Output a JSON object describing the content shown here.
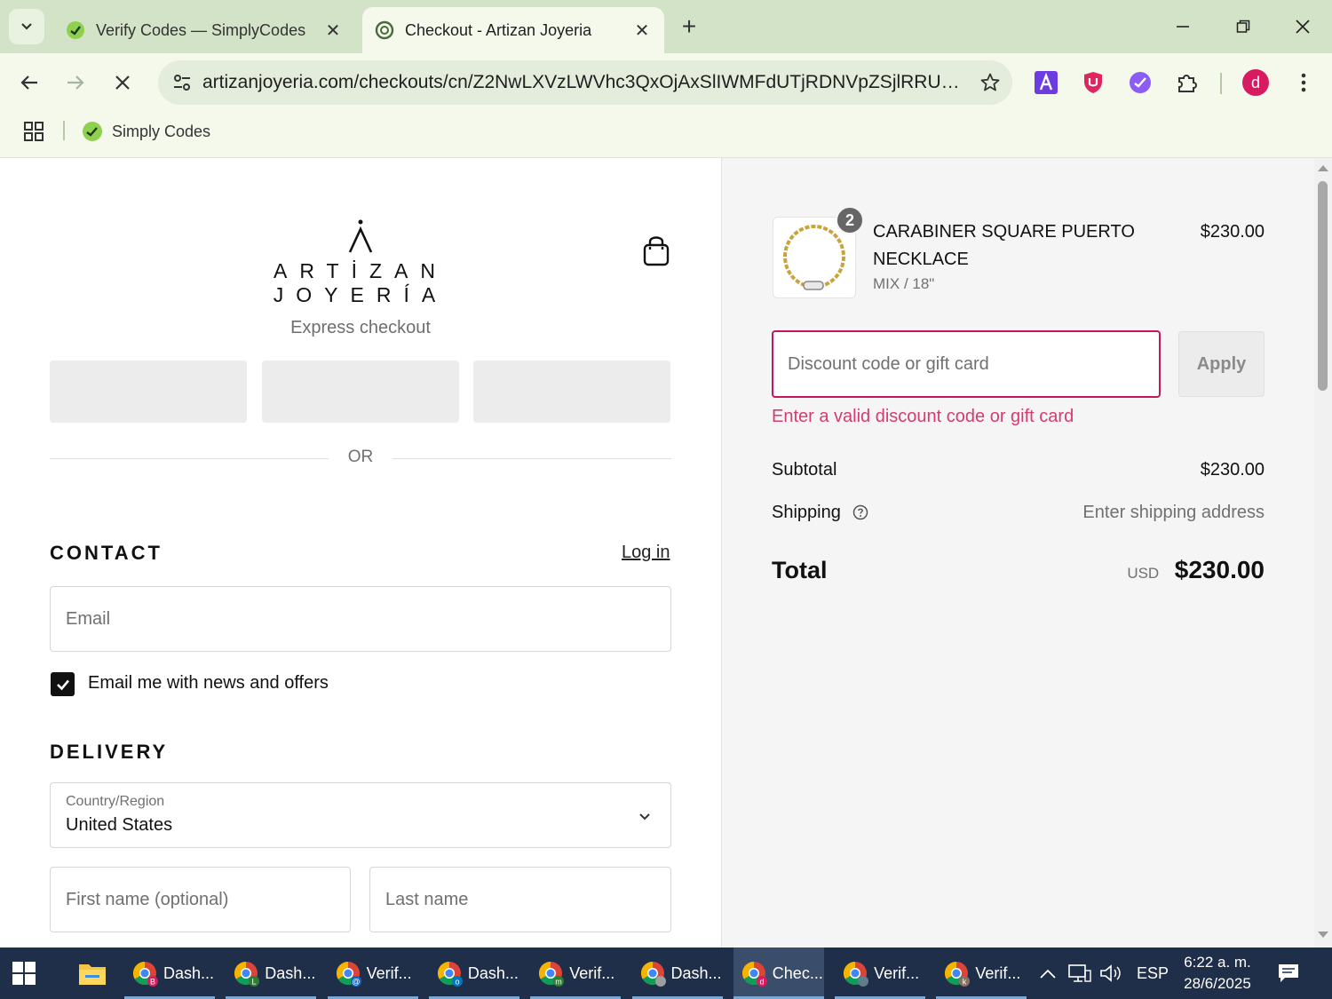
{
  "browser": {
    "tabs": [
      {
        "title": "Verify Codes — SimplyCodes",
        "active": false
      },
      {
        "title": "Checkout - Artizan Joyeria",
        "active": true
      }
    ],
    "url": "artizanjoyeria.com/checkouts/cn/Z2NwLXVzLWVhc3QxOjAxSlIWMFdUTjRDNVpZSjlRRUdGN...",
    "bookmarks": [
      {
        "label": "Simply Codes"
      }
    ],
    "profile_initial": "d"
  },
  "store": {
    "logo_text": "ARTİZAN JOYERÍA",
    "express_checkout_label": "Express checkout",
    "or_label": "OR"
  },
  "contact": {
    "heading": "CONTACT",
    "login_label": "Log in",
    "email_placeholder": "Email",
    "newsletter_label": "Email me with news and offers",
    "newsletter_checked": true
  },
  "delivery": {
    "heading": "DELIVERY",
    "country_label": "Country/Region",
    "country_value": "United States",
    "first_name_placeholder": "First name (optional)",
    "last_name_placeholder": "Last name"
  },
  "summary": {
    "item": {
      "quantity": "2",
      "name": "CARABINER SQUARE PUERTO NECKLACE",
      "variant": "MIX / 18\"",
      "price": "$230.00"
    },
    "discount_placeholder": "Discount code or gift card",
    "apply_label": "Apply",
    "error_message": "Enter a valid discount code or gift card",
    "subtotal_label": "Subtotal",
    "subtotal_value": "$230.00",
    "shipping_label": "Shipping",
    "shipping_value": "Enter shipping address",
    "total_label": "Total",
    "currency": "USD",
    "total_value": "$230.00"
  },
  "taskbar": {
    "items": [
      {
        "label": "Dash...",
        "badge": "B"
      },
      {
        "label": "Dash...",
        "badge": "L"
      },
      {
        "label": "Verif...",
        "badge": "@"
      },
      {
        "label": "Dash...",
        "badge": "o"
      },
      {
        "label": "Verif...",
        "badge": "m"
      },
      {
        "label": "Dash...",
        "badge": ""
      },
      {
        "label": "Chec...",
        "badge": "d"
      },
      {
        "label": "Verif...",
        "badge": ""
      },
      {
        "label": "Verif...",
        "badge": "k"
      }
    ],
    "language": "ESP",
    "time": "6:22 a. m.",
    "date": "28/6/2025"
  },
  "colors": {
    "accent_error": "#d63b6e",
    "browser_frame": "#d3e3c7",
    "taskbar": "#1f2f4a"
  }
}
